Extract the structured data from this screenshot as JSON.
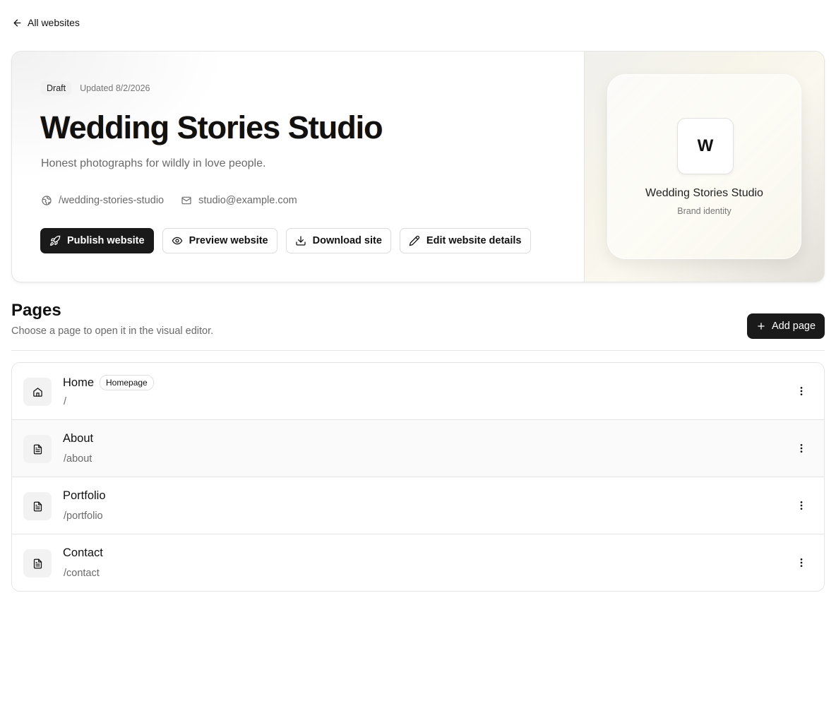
{
  "nav": {
    "back_label": "All websites"
  },
  "site": {
    "status": "Draft",
    "updated": "Updated 8/2/2026",
    "title": "Wedding Stories Studio",
    "tagline": "Honest photographs for wildly in love people.",
    "slug": "/wedding-stories-studio",
    "email": "studio@example.com"
  },
  "actions": {
    "publish": "Publish website",
    "preview": "Preview website",
    "download": "Download site",
    "edit": "Edit website details"
  },
  "brand": {
    "initial": "W",
    "name": "Wedding Stories Studio",
    "caption": "Brand identity"
  },
  "pages_section": {
    "title": "Pages",
    "subtitle": "Choose a page to open it in the visual editor.",
    "add_label": "Add page",
    "items": [
      {
        "name": "Home",
        "path": "/",
        "badge": "Homepage",
        "icon": "home-icon"
      },
      {
        "name": "About",
        "path": "/about",
        "icon": "document-icon"
      },
      {
        "name": "Portfolio",
        "path": "/portfolio",
        "icon": "document-icon"
      },
      {
        "name": "Contact",
        "path": "/contact",
        "icon": "document-icon"
      }
    ]
  },
  "colors": {
    "primary_button": "#1a1a1a",
    "muted_text": "#6a6a6a",
    "border": "#e4e4e4"
  }
}
